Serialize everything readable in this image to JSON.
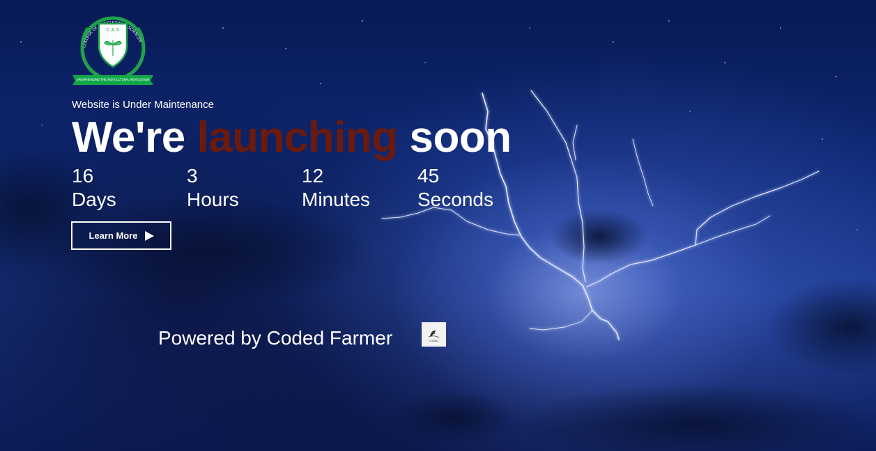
{
  "logo": {
    "arc_text": "COLLEGE OF AGRICULTURAL SCIENCES",
    "shield_text": "C.A.S",
    "ribbon_text": "SPEARHEADING THE AGRICULTURAL REVOLUTION",
    "colors": {
      "green": "#1fa24a",
      "ribbon": "#12a84a",
      "shield": "#ffffff"
    }
  },
  "hero": {
    "subtitle": "Website is Under Maintenance",
    "headline_prefix": "We're",
    "headline_accent": "launching",
    "headline_suffix": "soon",
    "accent_color": "#6b1a0c"
  },
  "countdown": [
    {
      "value": "16",
      "unit": "Days"
    },
    {
      "value": "3",
      "unit": "Hours"
    },
    {
      "value": "12",
      "unit": "Minutes"
    },
    {
      "value": "45",
      "unit": "Seconds"
    }
  ],
  "cta": {
    "label": "Learn More",
    "icon": "play-icon"
  },
  "footer": {
    "powered_by": "Powered by Coded Farmer",
    "partner_logo_text": "CODED"
  }
}
